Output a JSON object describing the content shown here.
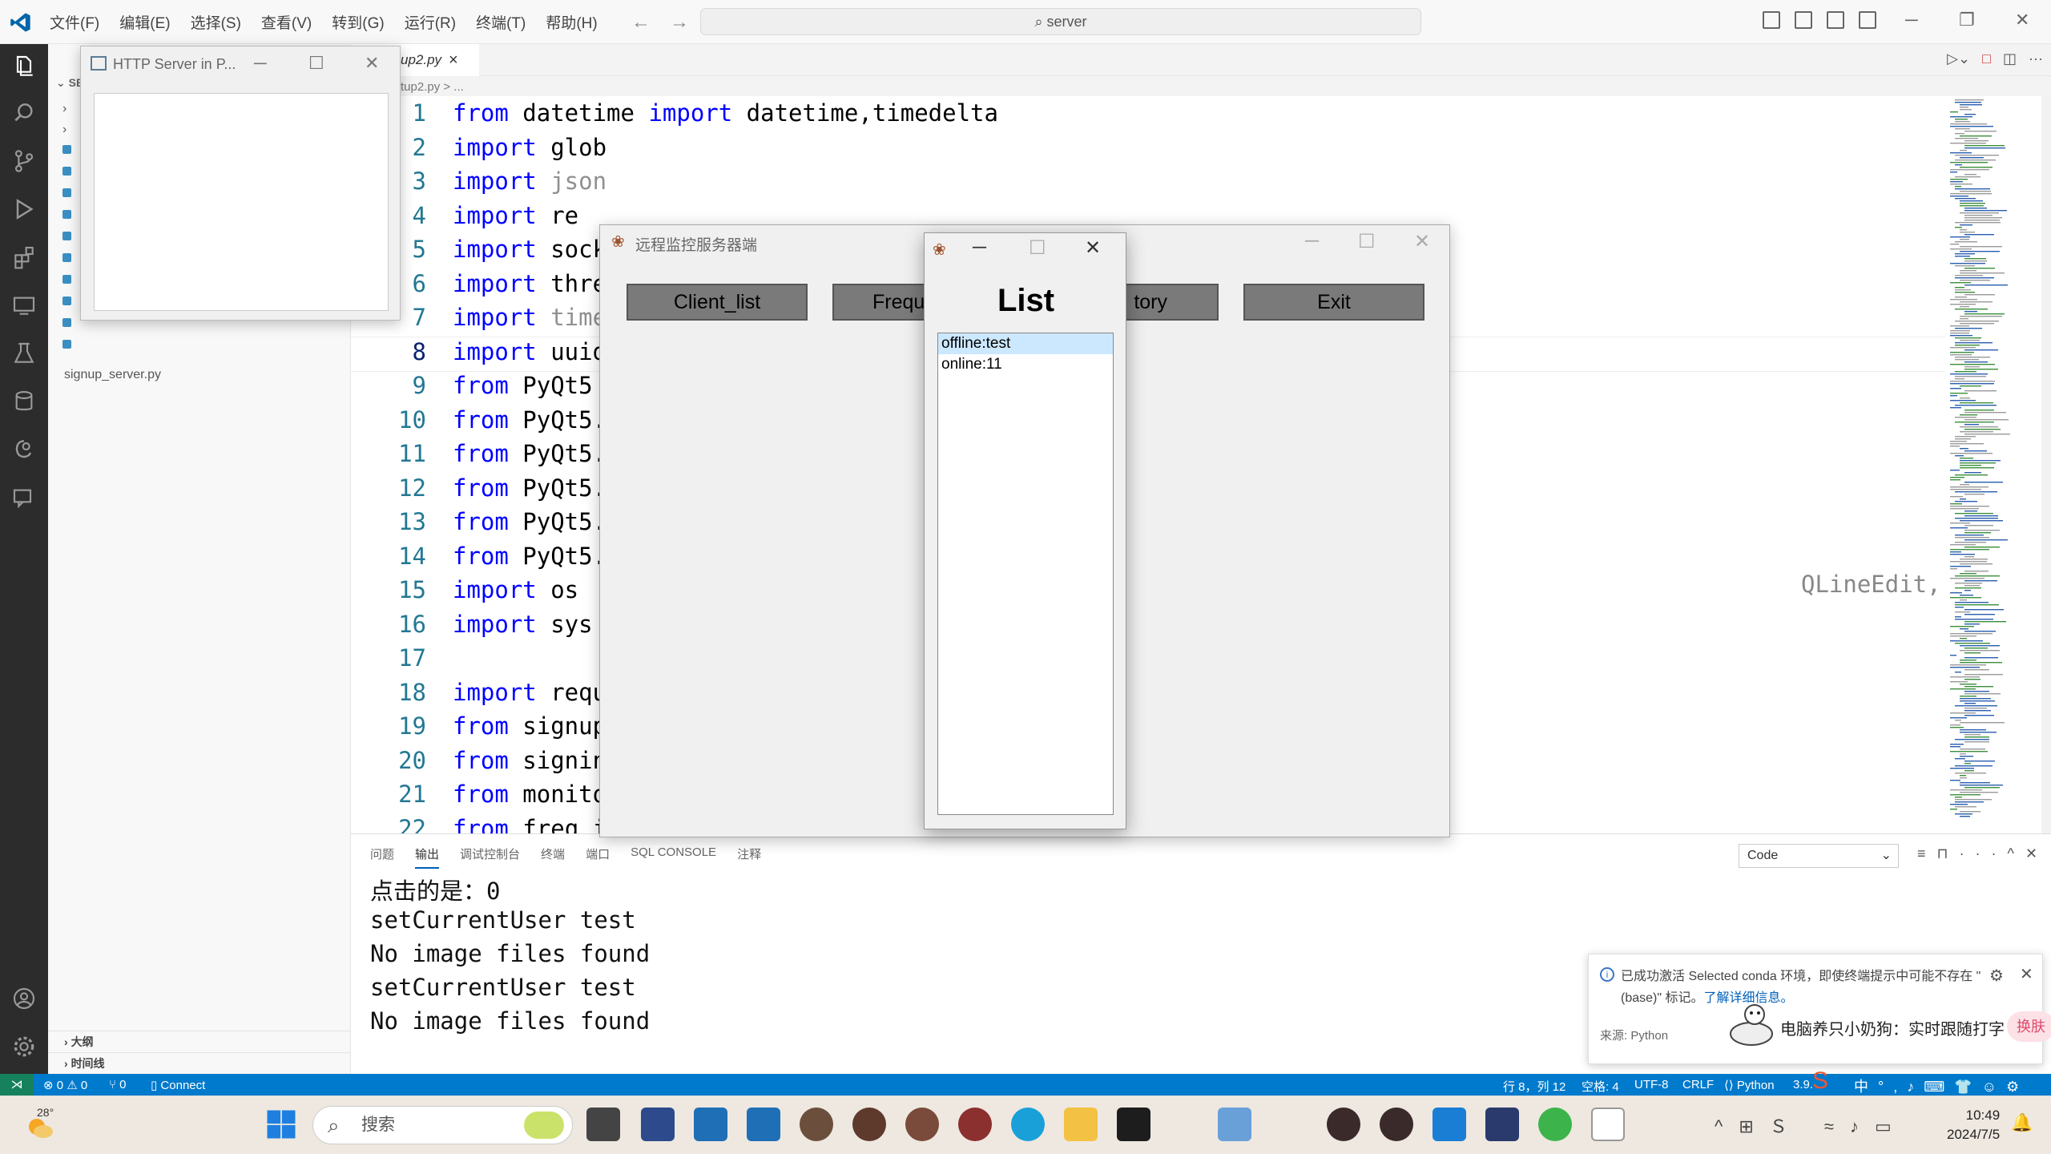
{
  "titlebar": {
    "menu": [
      "文件(F)",
      "编辑(E)",
      "选择(S)",
      "查看(V)",
      "转到(G)",
      "运行(R)",
      "终端(T)",
      "帮助(H)"
    ],
    "search": "server"
  },
  "sidebar": {
    "section_label": "SE",
    "file_label": "signup_server.py",
    "outline_label": "大纲",
    "timeline_label": "时间线"
  },
  "editor": {
    "tab_label": "up2.py",
    "breadcrumb": "tup2.py > ...",
    "lines": [
      {
        "n": "1",
        "kw": "from",
        "rest": " datetime ",
        "kw2": "import",
        "rest2": " datetime,timedelta"
      },
      {
        "n": "2",
        "kw": "import",
        "rest": " glob"
      },
      {
        "n": "3",
        "kw": "import",
        "gray": " json"
      },
      {
        "n": "4",
        "kw": "import",
        "rest": " re"
      },
      {
        "n": "5",
        "kw": "import",
        "rest": " sock"
      },
      {
        "n": "6",
        "kw": "import",
        "rest": " thre"
      },
      {
        "n": "7",
        "kw": "import",
        "gray": " time"
      },
      {
        "n": "8",
        "kw": "import",
        "rest": " uuid"
      },
      {
        "n": "9",
        "kw": "from",
        "rest": " PyQt5"
      },
      {
        "n": "10",
        "kw": "from",
        "rest": " PyQt5."
      },
      {
        "n": "11",
        "kw": "from",
        "rest": " PyQt5."
      },
      {
        "n": "12",
        "kw": "from",
        "rest": " PyQt5."
      },
      {
        "n": "13",
        "kw": "from",
        "rest": " PyQt5."
      },
      {
        "n": "14",
        "kw": "from",
        "rest": " PyQt5."
      },
      {
        "n": "15",
        "kw": "import",
        "rest": " os"
      },
      {
        "n": "16",
        "kw": "import",
        "rest": " sys"
      },
      {
        "n": "17"
      },
      {
        "n": "18",
        "kw": "import",
        "rest": " requ"
      },
      {
        "n": "19",
        "kw": "from",
        "rest": " signup"
      },
      {
        "n": "20",
        "kw": "from",
        "rest": " signin"
      },
      {
        "n": "21",
        "kw": "from",
        "rest": " monito"
      },
      {
        "n": "22",
        "kw": "from",
        "rest": " freq i"
      }
    ],
    "line12_tail": "QLineEdit, QPushButton, QTextEdit, ("
  },
  "panel": {
    "tabs": [
      "问题",
      "输出",
      "调试控制台",
      "终端",
      "端口",
      "SQL CONSOLE",
      "注释"
    ],
    "active_tab": "输出",
    "channel": "Code",
    "output": [
      "点击的是：0",
      "setCurrentUser test",
      "No image files found",
      "setCurrentUser test",
      "No image files found"
    ]
  },
  "notification": {
    "text": "已成功激活 Selected conda 环境，即使终端提示中可能不存在 \"(base)\" 标记。",
    "link": "了解详细信息。",
    "source": "来源: Python",
    "ime_text": "电脑养只小奶狗：实时跟随打字",
    "ime_button": "换肤"
  },
  "statusbar": {
    "problems": "⊗ 0 ⚠ 0",
    "ports": "⑂ 0",
    "connect": "Connect",
    "position": "行 8，列 12",
    "spaces": "空格: 4",
    "encoding": "UTF-8",
    "eol": "CRLF",
    "language": "Python",
    "version": "3.9."
  },
  "http_window": {
    "title": "HTTP Server in P..."
  },
  "monitor_window": {
    "title": "远程监控服务器端",
    "buttons": [
      "Client_list",
      "Frequ",
      "tory",
      "Exit"
    ]
  },
  "list_window": {
    "heading": "List",
    "items": [
      "offline:test",
      "online:11"
    ]
  },
  "taskbar": {
    "weather": "28°",
    "search_placeholder": "搜索",
    "time": "10:49",
    "date": "2024/7/5",
    "ime": "中"
  },
  "colors": {
    "accent": "#007acc",
    "keyword": "#0000ff",
    "remote": "#16825d"
  }
}
